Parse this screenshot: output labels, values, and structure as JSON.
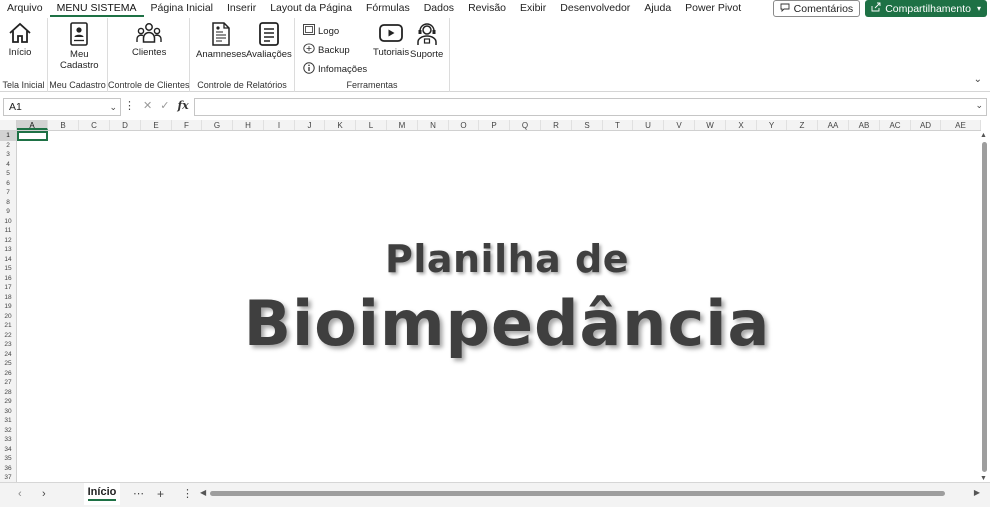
{
  "menu": {
    "tabs": [
      "Arquivo",
      "MENU SISTEMA",
      "Página Inicial",
      "Inserir",
      "Layout da Página",
      "Fórmulas",
      "Dados",
      "Revisão",
      "Exibir",
      "Desenvolvedor",
      "Ajuda",
      "Power Pivot"
    ],
    "active_tab": "MENU SISTEMA",
    "comments_label": "Comentários",
    "share_label": "Compartilhamento"
  },
  "ribbon": {
    "groups": {
      "tela_inicial": {
        "label": "Tela Inicial",
        "buttons": {
          "inicio": "Início"
        }
      },
      "meu_cadastro": {
        "label": "Meu Cadastro",
        "buttons": {
          "meu_cadastro_line1": "Meu",
          "meu_cadastro_line2": "Cadastro"
        }
      },
      "controle_clientes": {
        "label": "Controle de Clientes",
        "buttons": {
          "clientes": "Clientes"
        }
      },
      "controle_relatorios": {
        "label": "Controle de Relatórios",
        "buttons": {
          "anamneses": "Anamneses",
          "avaliacoes": "Avaliações"
        }
      },
      "ferramentas": {
        "label": "Ferramentas",
        "buttons": {
          "logo": "Logo",
          "backup": "Backup",
          "informacoes": "Infomações",
          "tutoriais": "Tutoriais",
          "suporte": "Suporte"
        }
      }
    }
  },
  "formula_bar": {
    "name_box": "A1",
    "fx_label": "fx",
    "value": ""
  },
  "sheet": {
    "columns": [
      "A",
      "B",
      "C",
      "D",
      "E",
      "F",
      "G",
      "H",
      "I",
      "J",
      "K",
      "L",
      "M",
      "N",
      "O",
      "P",
      "Q",
      "R",
      "S",
      "T",
      "U",
      "V",
      "W",
      "X",
      "Y",
      "Z",
      "AA",
      "AB",
      "AC",
      "AD",
      "AE"
    ],
    "rows": [
      "1",
      "2",
      "3",
      "4",
      "5",
      "6",
      "7",
      "8",
      "9",
      "10",
      "11",
      "12",
      "13",
      "14",
      "15",
      "16",
      "17",
      "18",
      "19",
      "20",
      "21",
      "22",
      "23",
      "24",
      "25",
      "26",
      "27",
      "28",
      "29",
      "30",
      "31",
      "32",
      "33",
      "34",
      "35",
      "36",
      "37"
    ],
    "title_line1": "Planilha de",
    "title_line2": "Bioimpedância"
  },
  "sheet_tabs": {
    "active": "Início"
  },
  "colors": {
    "accent": "#1e7145",
    "title_text": "#3f3f3f"
  }
}
